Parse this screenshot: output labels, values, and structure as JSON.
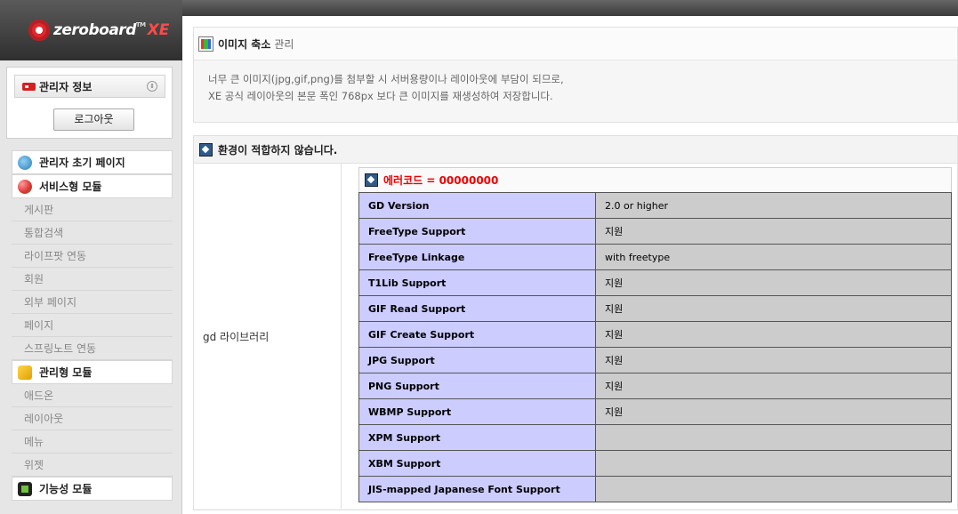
{
  "sidebar": {
    "logo_text": "zeroboard",
    "logo_tm": "TM",
    "logo_xe": "XE",
    "admin_title": "관리자 정보",
    "logout_label": "로그아웃",
    "items": [
      {
        "label": "관리자 초기 페이지",
        "type": "category",
        "icon": "globe-icon"
      },
      {
        "label": "서비스형 모듈",
        "type": "category",
        "icon": "service-module-icon"
      },
      {
        "label": "게시판",
        "type": "item"
      },
      {
        "label": "통합검색",
        "type": "item"
      },
      {
        "label": "라이프팟 연동",
        "type": "item"
      },
      {
        "label": "회원",
        "type": "item"
      },
      {
        "label": "외부 페이지",
        "type": "item"
      },
      {
        "label": "페이지",
        "type": "item"
      },
      {
        "label": "스프링노트 연동",
        "type": "item"
      },
      {
        "label": "관리형 모듈",
        "type": "category",
        "icon": "manage-module-icon"
      },
      {
        "label": "애드온",
        "type": "item"
      },
      {
        "label": "레이아웃",
        "type": "item"
      },
      {
        "label": "메뉴",
        "type": "item"
      },
      {
        "label": "위젯",
        "type": "item"
      },
      {
        "label": "기능성 모듈",
        "type": "category",
        "icon": "function-module-icon"
      }
    ]
  },
  "main": {
    "title": "이미지 축소",
    "title_sub": "관리",
    "desc_line1": "너무 큰 이미지(jpg,gif,png)를 첨부할 시 서버용량이나 레이아웃에 부담이 되므로,",
    "desc_line2": "XE 공식 레이아웃의 본문 폭인 768px 보다 큰 이미지를 재생성하여 저장합니다.",
    "env_title": "환경이 적합하지 않습니다.",
    "gd_label": "gd 라이브러리",
    "error_code": "에러코드 = 00000000",
    "gd_rows": [
      {
        "key": "GD Version",
        "value": "2.0 or higher"
      },
      {
        "key": "FreeType Support",
        "value": "지원"
      },
      {
        "key": "FreeType Linkage",
        "value": "with freetype"
      },
      {
        "key": "T1Lib Support",
        "value": "지원"
      },
      {
        "key": "GIF Read Support",
        "value": "지원"
      },
      {
        "key": "GIF Create Support",
        "value": "지원"
      },
      {
        "key": "JPG Support",
        "value": "지원"
      },
      {
        "key": "PNG Support",
        "value": "지원"
      },
      {
        "key": "WBMP Support",
        "value": "지원"
      },
      {
        "key": "XPM Support",
        "value": ""
      },
      {
        "key": "XBM Support",
        "value": ""
      },
      {
        "key": "JIS-mapped Japanese Font Support",
        "value": ""
      }
    ]
  },
  "colors": {
    "error_red": "#ee0000",
    "table_key_bg": "#ccccff",
    "table_value_bg": "#cccccc"
  }
}
